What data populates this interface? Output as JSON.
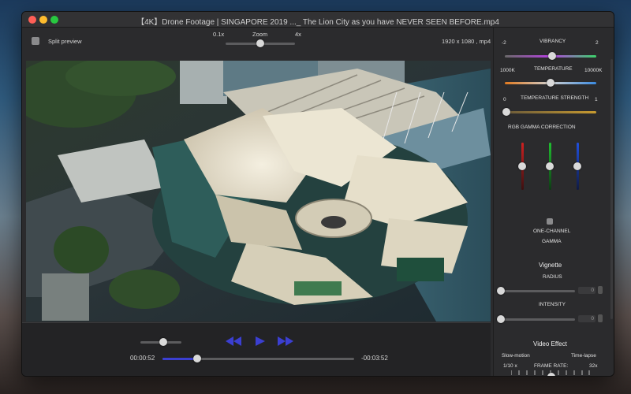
{
  "window": {
    "title": "【4K】Drone Footage | SINGAPORE 2019 ..._ The Lion City as you have NEVER SEEN BEFORE.mp4"
  },
  "toolbar": {
    "split_preview_label": "Split preview",
    "zoom_label": "Zoom",
    "zoom_min": "0.1x",
    "zoom_max": "4x",
    "zoom_level": 0.5,
    "resolution_info": "1920 x 1080 , mp4"
  },
  "playback": {
    "current_time": "00:00:52",
    "remaining_time": "-00:03:52",
    "progress": 0.18,
    "volume": 0.55
  },
  "side_panel": {
    "vibrancy": {
      "label": "VIBRANCY",
      "min": "-2",
      "max": "2",
      "value": 0.52
    },
    "temperature": {
      "label": "TEMPERATURE",
      "min": "1000K",
      "max": "10000K",
      "value": 0.5
    },
    "temperature_strength": {
      "label": "TEMPERATURE STRENGTH",
      "min": "0",
      "max": "1",
      "value": 0.02
    },
    "rgb_gamma": {
      "label": "RGB GAMMA CORRECTION",
      "red": 0.5,
      "green": 0.5,
      "blue": 0.5,
      "one_channel_label": "ONE-CHANNEL",
      "gamma_label": "GAMMA"
    },
    "vignette": {
      "title": "Vignette",
      "radius_label": "RADIUS",
      "radius_value": "0",
      "intensity_label": "INTENSITY",
      "intensity_value": "0"
    },
    "video_effect": {
      "title": "Video Effect",
      "slow_motion_label": "Slow-motion",
      "time_lapse_label": "Time-lapse",
      "min_label": "1/10 x",
      "frame_rate_label": "FRAME RATE:",
      "max_label": "32x",
      "frame_rate_position": 0.52
    }
  },
  "colors": {
    "accent_blue": "#3b3fd1",
    "red_channel": "#d02020",
    "green_channel": "#20c030",
    "blue_channel": "#2050e0"
  }
}
